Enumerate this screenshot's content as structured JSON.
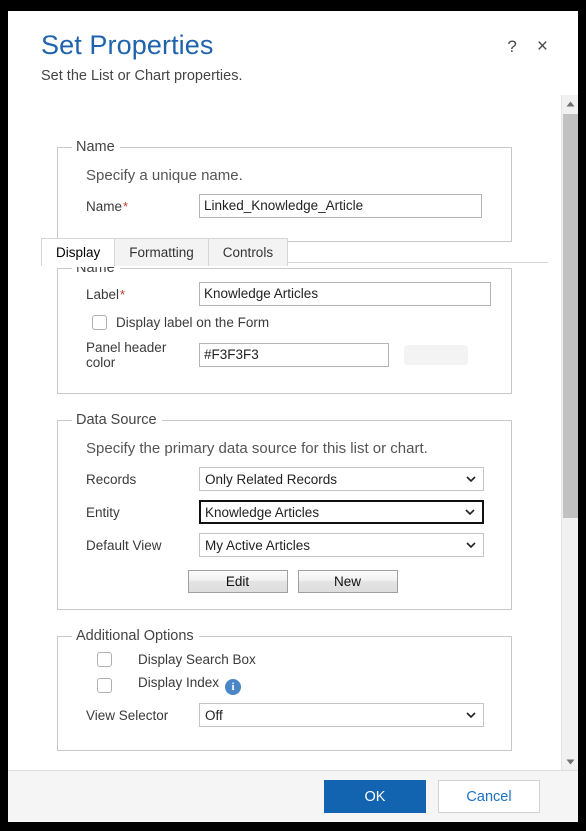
{
  "dialog": {
    "title": "Set Properties",
    "subtitle": "Set the List or Chart properties.",
    "help_icon": "?",
    "close_icon": "×"
  },
  "tabs": [
    {
      "label": "Display"
    },
    {
      "label": "Formatting"
    },
    {
      "label": "Controls"
    }
  ],
  "name_group": {
    "legend": "Name",
    "description": "Specify a unique name.",
    "name_label": "Name",
    "required_mark": "*",
    "name_value": "Linked_Knowledge_Article"
  },
  "label_group": {
    "legend": "Name",
    "label_label": "Label",
    "required_mark": "*",
    "label_value": "Knowledge Articles",
    "display_label_checkbox": "Display label on the Form",
    "panel_header_color_label": "Panel header color",
    "panel_header_color_value": "#F3F3F3",
    "swatch_color": "#F3F3F3"
  },
  "data_source": {
    "legend": "Data Source",
    "description": "Specify the primary data source for this list or chart.",
    "records_label": "Records",
    "records_value": "Only Related Records",
    "entity_label": "Entity",
    "entity_value": "Knowledge Articles",
    "default_view_label": "Default View",
    "default_view_value": "My Active Articles",
    "edit_button": "Edit",
    "new_button": "New"
  },
  "additional_options": {
    "legend": "Additional Options",
    "display_search_box": "Display Search Box",
    "display_index": "Display Index",
    "info_icon": "i",
    "view_selector_label": "View Selector",
    "view_selector_value": "Off"
  },
  "footer": {
    "ok_label": "OK",
    "cancel_label": "Cancel"
  },
  "colors": {
    "accent": "#1263b0",
    "title": "#1f63ad",
    "required": "#c0392b",
    "info": "#4a86c5"
  }
}
